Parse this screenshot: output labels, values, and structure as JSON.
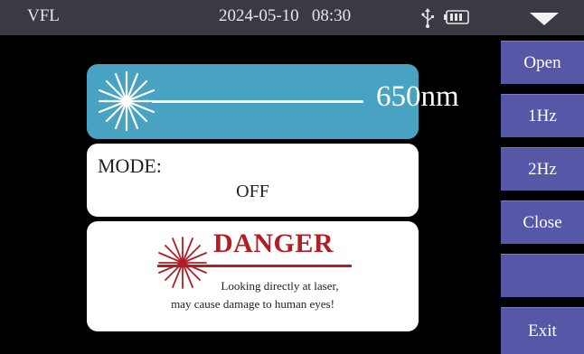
{
  "statusbar": {
    "title": "VFL",
    "datetime": "2024-05-10   08:30",
    "usb_icon": "usb-icon",
    "battery_icon": "battery-icon",
    "menu_icon": "dropdown-arrow-icon"
  },
  "laser": {
    "wavelength": "650nm",
    "icon": "laser-burst-icon"
  },
  "mode": {
    "label": "MODE:",
    "value": "OFF"
  },
  "danger": {
    "title": "DANGER",
    "line1": "Looking directly at laser,",
    "line2": "may cause damage to human eyes!",
    "icon": "laser-warning-icon"
  },
  "sidebar": {
    "buttons": [
      {
        "label": "Open"
      },
      {
        "label": "1Hz"
      },
      {
        "label": "2Hz"
      },
      {
        "label": "Close"
      },
      {
        "label": ""
      },
      {
        "label": "Exit"
      }
    ]
  },
  "colors": {
    "statusbar": "#3a3a44",
    "button": "#5757a8",
    "wave_panel": "#48a3c2",
    "danger": "#b21e24"
  }
}
